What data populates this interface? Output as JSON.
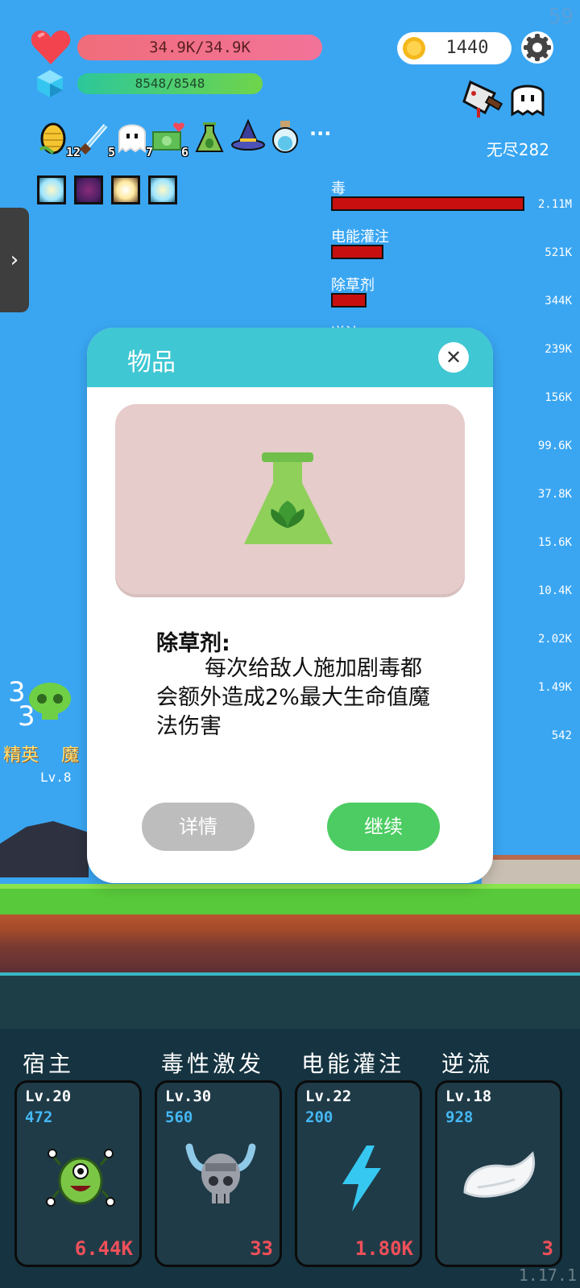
{
  "fps": "59",
  "player": {
    "hp_text": "34.9K/34.9K",
    "mp_text": "8548/8548"
  },
  "coins": "1440",
  "stage": "无尽282",
  "items": [
    {
      "icon": "corn-icon",
      "count": "12"
    },
    {
      "icon": "sword-icon",
      "count": "5"
    },
    {
      "icon": "ghost-icon",
      "count": "7"
    },
    {
      "icon": "cash-heart-icon",
      "count": "6"
    },
    {
      "icon": "flask-icon",
      "count": ""
    },
    {
      "icon": "wizard-hat-icon",
      "count": ""
    },
    {
      "icon": "potion-icon",
      "count": ""
    }
  ],
  "more_label": "···",
  "damage_stats": [
    {
      "name": "毒",
      "value": "2.11M",
      "fraction": 1.0
    },
    {
      "name": "电能灌注",
      "value": "521K",
      "fraction": 0.27
    },
    {
      "name": "除草剂",
      "value": "344K",
      "fraction": 0.18
    },
    {
      "name": "逆流",
      "value": "239K",
      "fraction": 0.12
    },
    {
      "name": "",
      "value": "156K",
      "fraction": 0.08
    },
    {
      "name": "",
      "value": "99.6K",
      "fraction": 0.05
    },
    {
      "name": "",
      "value": "37.8K",
      "fraction": 0.02
    },
    {
      "name": "",
      "value": "15.6K",
      "fraction": 0.01
    },
    {
      "name": "",
      "value": "10.4K",
      "fraction": 0.01
    },
    {
      "name": "",
      "value": "2.02K",
      "fraction": 0.0
    },
    {
      "name": "",
      "value": "1.49K",
      "fraction": 0.0
    },
    {
      "name": "",
      "value": "542",
      "fraction": 0.0
    }
  ],
  "battlefield": {
    "float_1": "精英",
    "float_2": "魔",
    "float_3": "Lv.8",
    "num_1": "3",
    "num_2": "3"
  },
  "modal": {
    "title": "物品",
    "item_name": "除草剂:",
    "item_desc": "每次给敌人施加剧毒都会额外造成2%最大生命值魔法伤害",
    "detail_label": "详情",
    "continue_label": "继续"
  },
  "skills": [
    {
      "name": "宿主",
      "level": "Lv.20",
      "value": "472",
      "foot": "6.44K",
      "icon": "virus-monster-icon"
    },
    {
      "name": "毒性激发",
      "level": "Lv.30",
      "value": "560",
      "foot": "33",
      "icon": "viking-skull-icon"
    },
    {
      "name": "电能灌注",
      "level": "Lv.22",
      "value": "200",
      "foot": "1.80K",
      "icon": "lightning-icon"
    },
    {
      "name": "逆流",
      "level": "Lv.18",
      "value": "928",
      "foot": "3",
      "icon": "wing-icon"
    }
  ],
  "version": "1.17.1",
  "colors": {
    "sky": "#3aa6f2",
    "hp_bar": "#f06d7a",
    "mp_bar": "#2cc79a",
    "modal_header": "#3fc7d3",
    "continue_button": "#4ccc62",
    "damage_bar": "#c80f0f",
    "skill_value": "#45b8f5",
    "skill_foot": "#f0505a"
  }
}
